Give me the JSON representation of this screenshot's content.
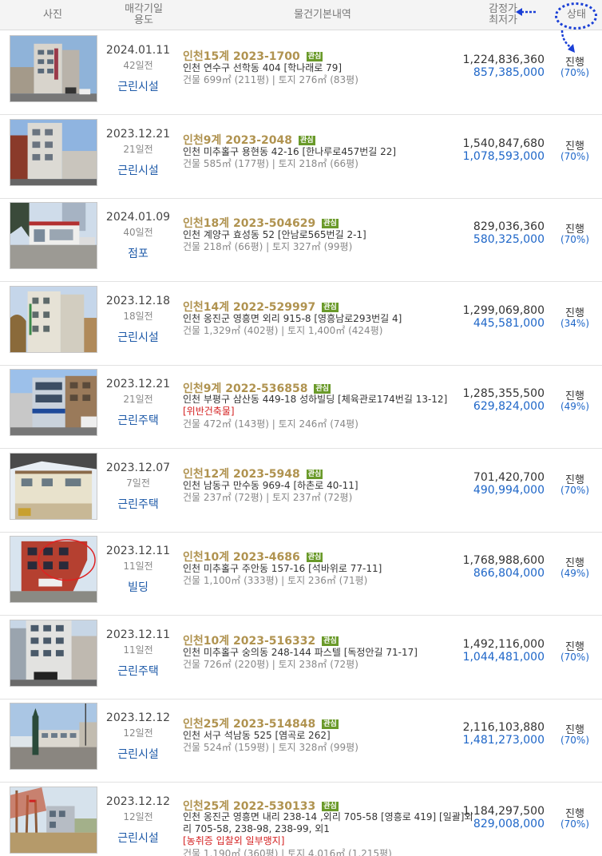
{
  "header": {
    "photo": "사진",
    "date_l1": "매각기일",
    "date_l2": "용도",
    "info": "물건기본내역",
    "price_l1": "감정가",
    "price_l2": "최저가",
    "status": "상태"
  },
  "colors": {
    "case": "#b09350",
    "use": "#1e5aa8",
    "min_price": "#1e66c8",
    "warning": "#d42020",
    "badge": "#6a9a2a",
    "annotation": "#1a3fd6"
  },
  "rows": [
    {
      "date": "2024.01.11",
      "ago": "42일전",
      "use": "근린시설",
      "case": "인천15계 2023-1700",
      "badge": "관심",
      "addr": "인천 연수구 선학동 404 [학나래로 79]",
      "addr2": "",
      "warn": "",
      "area": "건물 699㎡ (211평)   |   토지 276㎡ (83평)",
      "appraisal": "1,224,836,360",
      "min": "857,385,000",
      "status": "진행",
      "pct": "(70%)"
    },
    {
      "date": "2023.12.21",
      "ago": "21일전",
      "use": "근린시설",
      "case": "인천9계 2023-2048",
      "badge": "관심",
      "addr": "인천 미추홀구 용현동 42-16 [한나루로457번길 22]",
      "addr2": "",
      "warn": "",
      "area": "건물 585㎡ (177평)   |   토지 218㎡ (66평)",
      "appraisal": "1,540,847,680",
      "min": "1,078,593,000",
      "status": "진행",
      "pct": "(70%)"
    },
    {
      "date": "2024.01.09",
      "ago": "40일전",
      "use": "점포",
      "case": "인천18계 2023-504629",
      "badge": "관심",
      "addr": "인천 계양구 효성동 52 [안남로565번길 2-1]",
      "addr2": "",
      "warn": "",
      "area": "건물 218㎡ (66평)   |   토지 327㎡ (99평)",
      "appraisal": "829,036,360",
      "min": "580,325,000",
      "status": "진행",
      "pct": "(70%)"
    },
    {
      "date": "2023.12.18",
      "ago": "18일전",
      "use": "근린시설",
      "case": "인천14계 2022-529997",
      "badge": "관심",
      "addr": "인천 옹진군 영흥면 외리 915-8 [영흥남로293번길 4]",
      "addr2": "",
      "warn": "",
      "area": "건물 1,329㎡ (402평)   |   토지 1,400㎡ (424평)",
      "appraisal": "1,299,069,800",
      "min": "445,581,000",
      "status": "진행",
      "pct": "(34%)"
    },
    {
      "date": "2023.12.21",
      "ago": "21일전",
      "use": "근린주택",
      "case": "인천9계 2022-536858",
      "badge": "관심",
      "addr": "인천 부평구 삼산동 449-18 성하빌딩 [체육관로174번길 13-12]",
      "addr2": "",
      "warn": "[위반건축물]",
      "area": "건물 472㎡ (143평)   |   토지 246㎡ (74평)",
      "appraisal": "1,285,355,500",
      "min": "629,824,000",
      "status": "진행",
      "pct": "(49%)"
    },
    {
      "date": "2023.12.07",
      "ago": "7일전",
      "use": "근린주택",
      "case": "인천12계 2023-5948",
      "badge": "관심",
      "addr": "인천 남동구 만수동 969-4 [하촌로 40-11]",
      "addr2": "",
      "warn": "",
      "area": "건물 237㎡ (72평)   |   토지 237㎡ (72평)",
      "appraisal": "701,420,700",
      "min": "490,994,000",
      "status": "진행",
      "pct": "(70%)"
    },
    {
      "date": "2023.12.11",
      "ago": "11일전",
      "use": "빌딩",
      "case": "인천10계 2023-4686",
      "badge": "관심",
      "addr": "인천 미추홀구 주안동 157-16 [석바위로 77-11]",
      "addr2": "",
      "warn": "",
      "area": "건물 1,100㎡ (333평)   |   토지 236㎡ (71평)",
      "appraisal": "1,768,988,600",
      "min": "866,804,000",
      "status": "진행",
      "pct": "(49%)"
    },
    {
      "date": "2023.12.11",
      "ago": "11일전",
      "use": "근린주택",
      "case": "인천10계 2023-516332",
      "badge": "관심",
      "addr": "인천 미추홀구 숭의동 248-144 파스텔 [독정안길 71-17]",
      "addr2": "",
      "warn": "",
      "area": "건물 726㎡ (220평)   |   토지 238㎡ (72평)",
      "appraisal": "1,492,116,000",
      "min": "1,044,481,000",
      "status": "진행",
      "pct": "(70%)"
    },
    {
      "date": "2023.12.12",
      "ago": "12일전",
      "use": "근린시설",
      "case": "인천25계 2023-514848",
      "badge": "관심",
      "addr": "인천 서구 석남동 525 [염곡로 262]",
      "addr2": "",
      "warn": "",
      "area": "건물 524㎡ (159평)   |   토지 328㎡ (99평)",
      "appraisal": "2,116,103,880",
      "min": "1,481,273,000",
      "status": "진행",
      "pct": "(70%)"
    },
    {
      "date": "2023.12.12",
      "ago": "12일전",
      "use": "근린시설",
      "case": "인천25계 2022-530133",
      "badge": "관심",
      "addr": "인천 옹진군 영흥면 내리 238-14 ,외리 705-58 [영흥로 419]  [일괄]외",
      "addr2": "리 705-58, 238-98, 238-99, 외1",
      "warn": "[농취증   입찰외   일부맹지]",
      "area": "건물 1,190㎡ (360평)   |   토지 4,016㎡ (1,215평)",
      "appraisal": "1,184,297,500",
      "min": "829,008,000",
      "status": "진행",
      "pct": "(70%)"
    }
  ]
}
